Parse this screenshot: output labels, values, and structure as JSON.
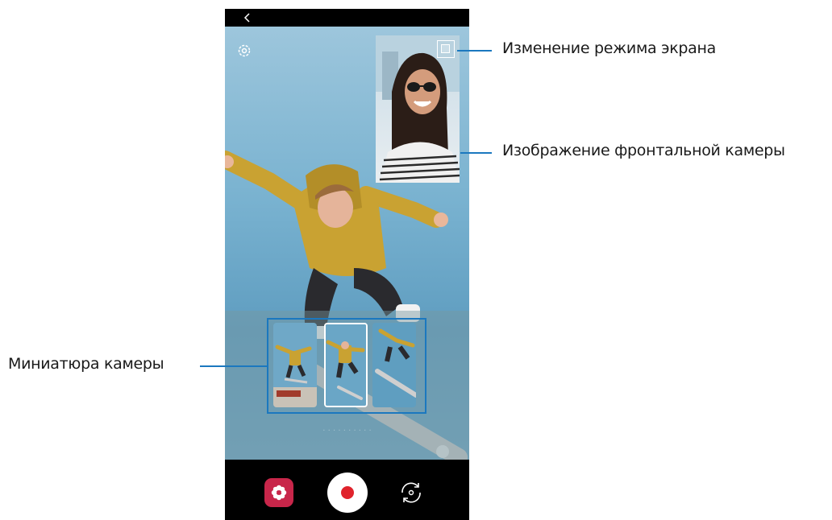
{
  "callouts": {
    "screen_mode": "Изменение режима экрана",
    "front_camera": "Изображение фронтальной камеры",
    "camera_thumbnail": "Миниатюра камеры"
  },
  "icons": {
    "back": "chevron-left-icon",
    "settings": "gear-icon",
    "screen_mode": "screen-mode-icon",
    "filter": "flower-icon",
    "record": "record-icon",
    "switch_camera": "switch-camera-icon"
  },
  "colors": {
    "callout_accent": "#1b78bf",
    "record_dot": "#e0232c",
    "filter_button": "#c8264a"
  }
}
